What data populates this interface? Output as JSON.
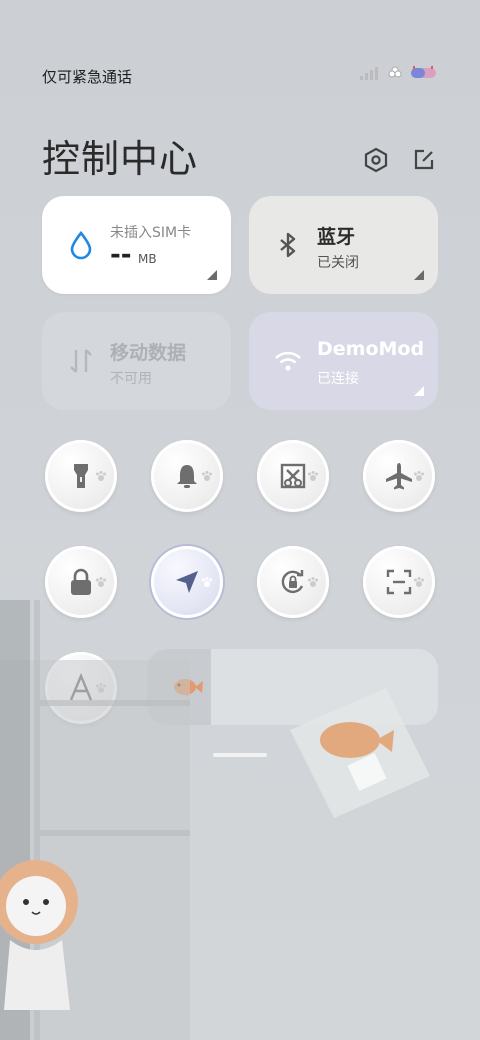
{
  "status_bar": {
    "carrier_text": "仅可紧急通话",
    "icons": [
      "signal-icon",
      "flower-icon",
      "battery-icon"
    ]
  },
  "header": {
    "title": "控制中心",
    "settings_icon": "hexagon-settings-icon",
    "edit_icon": "edit-icon"
  },
  "tiles": {
    "data_usage": {
      "subtitle": "未插入SIM卡",
      "value": "--",
      "unit": "MB",
      "icon": "water-drop-icon",
      "accent": "#1e88e5"
    },
    "bluetooth": {
      "label": "蓝牙",
      "status": "已关闭",
      "icon": "bluetooth-icon"
    },
    "mobile_data": {
      "label": "移动数据",
      "status": "不可用",
      "icon": "data-arrows-icon"
    },
    "wifi": {
      "label": "DemoMod",
      "status": "已连接",
      "icon": "wifi-icon"
    }
  },
  "toggles": [
    {
      "name": "flashlight",
      "icon": "flashlight-icon",
      "active": false
    },
    {
      "name": "sound",
      "icon": "bell-icon",
      "active": false
    },
    {
      "name": "screenshot",
      "icon": "screenshot-icon",
      "active": false
    },
    {
      "name": "airplane",
      "icon": "airplane-icon",
      "active": false
    },
    {
      "name": "lock",
      "icon": "lock-icon",
      "active": false
    },
    {
      "name": "location",
      "icon": "location-arrow-icon",
      "active": true
    },
    {
      "name": "rotation-lock",
      "icon": "rotation-lock-icon",
      "active": false
    },
    {
      "name": "scanner",
      "icon": "scan-icon",
      "active": false
    },
    {
      "name": "font",
      "icon": "font-a-icon",
      "active": false
    }
  ],
  "brightness": {
    "level": 0.22,
    "thumb_icon": "fish-icon"
  },
  "colors": {
    "accent_blue": "#1e88e5",
    "icon_gray": "#6e6e6e"
  }
}
